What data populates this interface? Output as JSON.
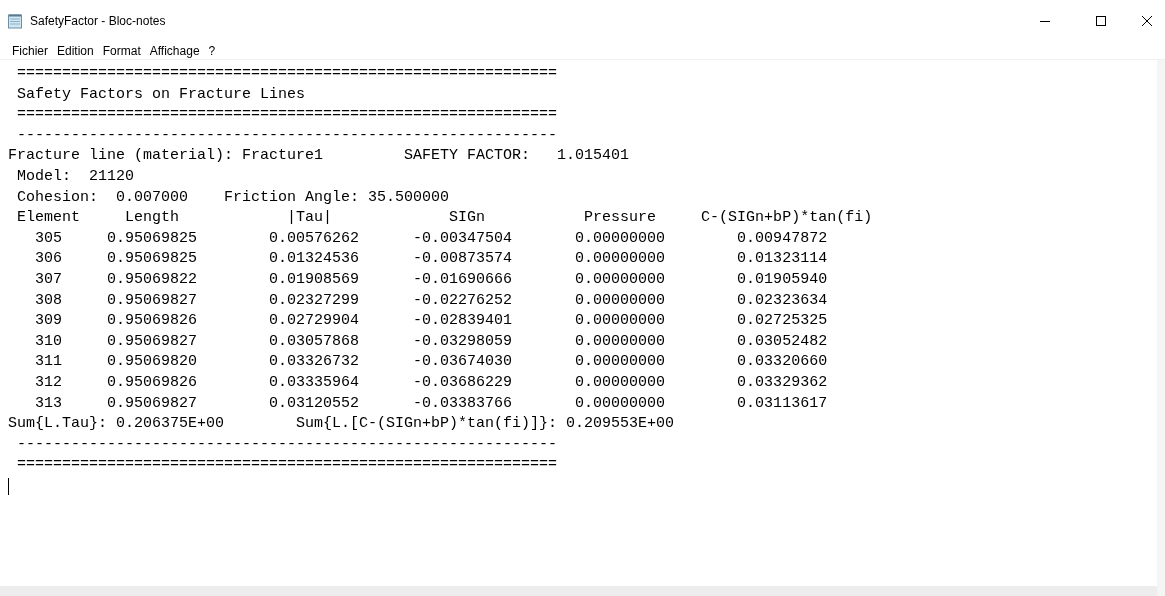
{
  "window": {
    "title": "SafetyFactor - Bloc-notes"
  },
  "menu": [
    "Fichier",
    "Edition",
    "Format",
    "Affichage",
    "?"
  ],
  "lines": [
    " ============================================================",
    " Safety Factors on Fracture Lines",
    " ============================================================",
    " ------------------------------------------------------------",
    "Fracture line (material): Fracture1         SAFETY FACTOR:   1.015401",
    " Model:  21120",
    " Cohesion:  0.007000    Friction Angle: 35.500000",
    " Element     Length            |Tau|             SIGn           Pressure     C-(SIGn+bP)*tan(fi)",
    "   305     0.95069825        0.00576262      -0.00347504       0.00000000        0.00947872",
    "   306     0.95069825        0.01324536      -0.00873574       0.00000000        0.01323114",
    "   307     0.95069822        0.01908569      -0.01690666       0.00000000        0.01905940",
    "   308     0.95069827        0.02327299      -0.02276252       0.00000000        0.02323634",
    "   309     0.95069826        0.02729904      -0.02839401       0.00000000        0.02725325",
    "   310     0.95069827        0.03057868      -0.03298059       0.00000000        0.03052482",
    "   311     0.95069820        0.03326732      -0.03674030       0.00000000        0.03320660",
    "   312     0.95069826        0.03335964      -0.03686229       0.00000000        0.03329362",
    "   313     0.95069827        0.03120552      -0.03383766       0.00000000        0.03113617",
    "Sum{L.Tau}: 0.206375E+00        Sum{L.[C-(SIGn+bP)*tan(fi)]}: 0.209553E+00",
    " ------------------------------------------------------------",
    " ============================================================"
  ]
}
